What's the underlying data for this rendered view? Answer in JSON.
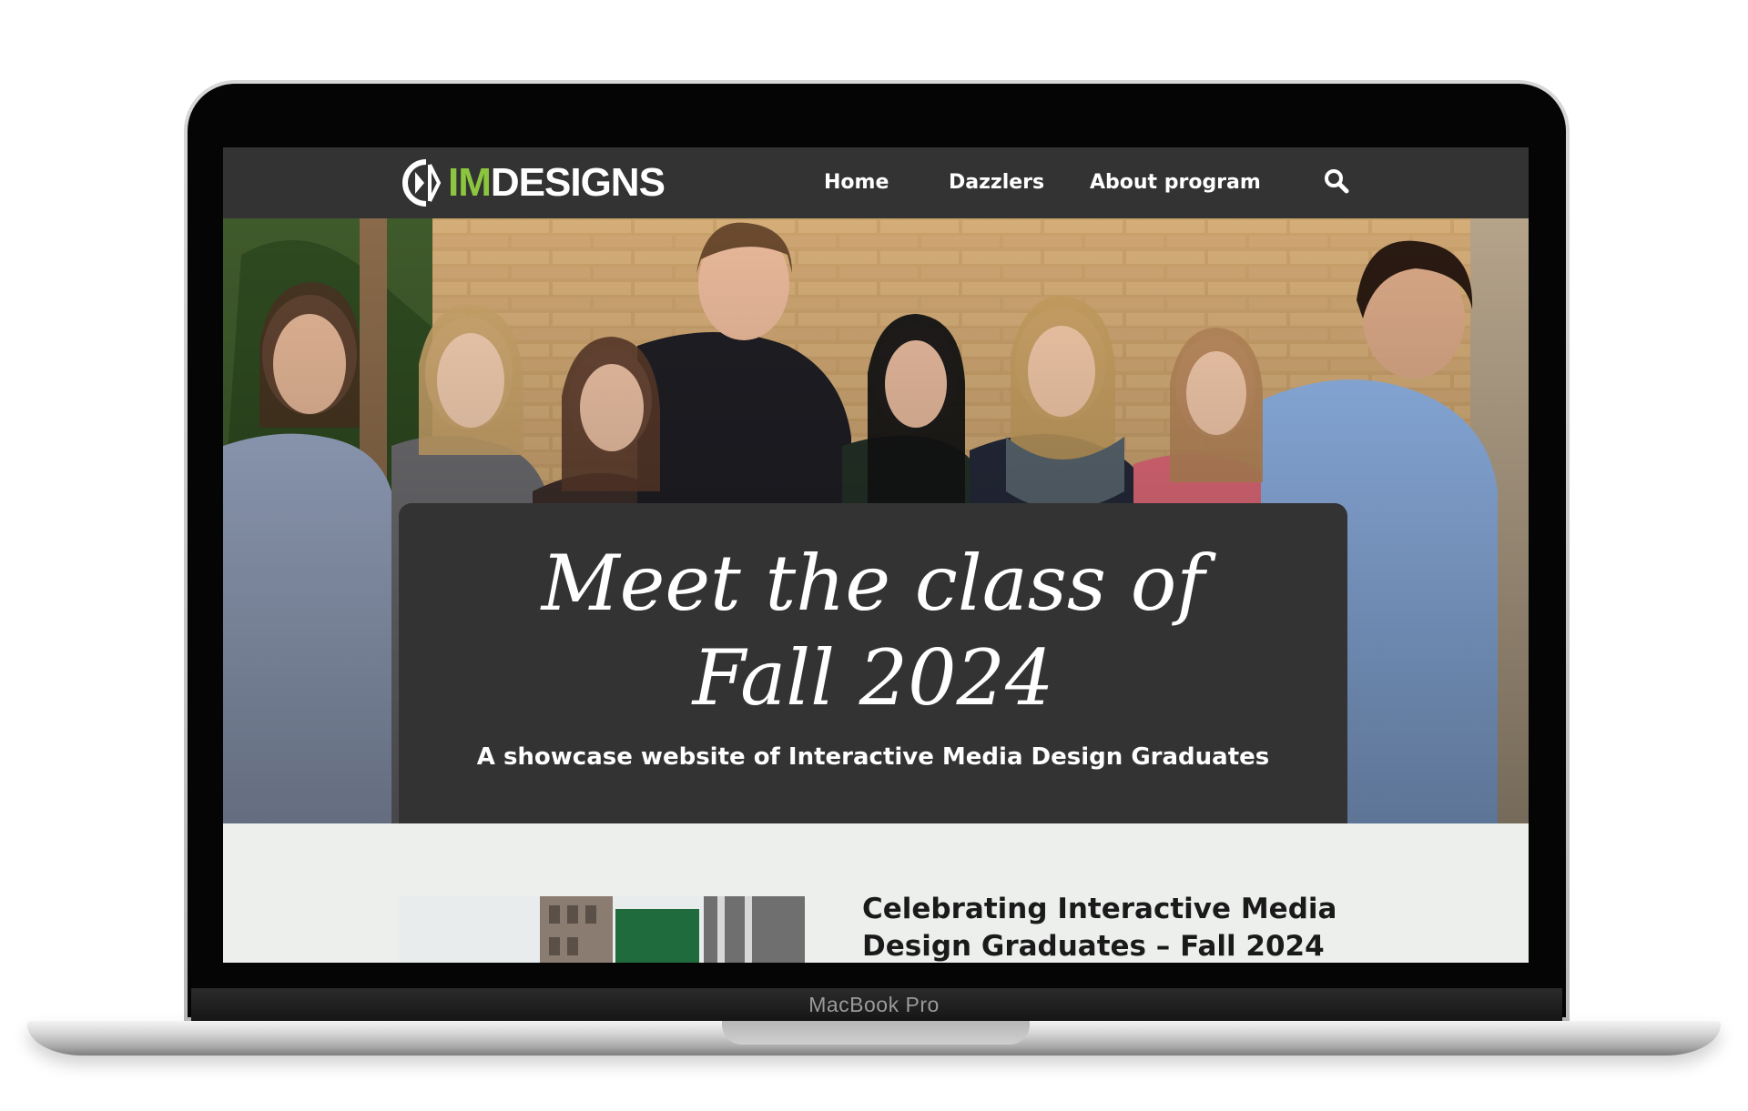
{
  "device": {
    "model_label": "MacBook Pro"
  },
  "header": {
    "logo": {
      "im": "IM",
      "designs": "DESIGNS",
      "accent_color": "#8cc63f"
    },
    "nav": [
      {
        "label": "Home"
      },
      {
        "label": "Dazzlers"
      },
      {
        "label": "About program"
      }
    ],
    "search_icon": "search-icon"
  },
  "hero": {
    "title_line1": "Meet the class of",
    "title_line2": "Fall 2024",
    "subtitle": "A showcase website of Interactive Media Design Graduates",
    "card_color": "#333333"
  },
  "article": {
    "title": "Celebrating Interactive Media Design Graduates – Fall 2024"
  },
  "colors": {
    "header_bg": "#333333",
    "content_bg": "#ecefec"
  }
}
